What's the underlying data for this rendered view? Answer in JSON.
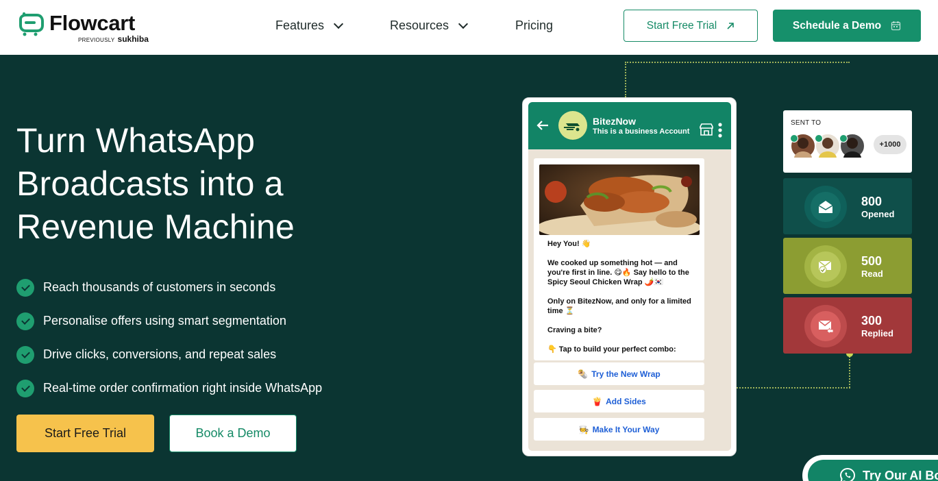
{
  "brand": {
    "name": "Flowcart",
    "previously": "PREVIOUSLY",
    "previous_name": "sukhiba",
    "accent": "#16906b",
    "dark_bg": "#0b3532"
  },
  "nav": {
    "items": [
      {
        "label": "Features",
        "icon": "chevron-down-icon"
      },
      {
        "label": "Resources",
        "icon": "chevron-down-icon"
      },
      {
        "label": "Pricing"
      }
    ],
    "trial_label": "Start Free Trial",
    "trial_icon": "arrow-up-right-icon",
    "demo_label": "Schedule a Demo",
    "demo_icon": "calendar-icon"
  },
  "hero": {
    "title_lines": [
      "Turn WhatsApp",
      "Broadcasts into a",
      "Revenue Machine"
    ],
    "bullets": [
      "Reach thousands of customers in seconds",
      "Personalise offers using smart segmentation",
      "Drive clicks, conversions, and repeat sales",
      "Real-time order confirmation right inside WhatsApp"
    ],
    "cta_primary": "Start Free Trial",
    "cta_primary_color": "#f6c24c",
    "cta_secondary": "Book a Demo"
  },
  "phone": {
    "contact_name": "BitezNow",
    "contact_sub": "This is a business Account",
    "message_lines": [
      "Hey You! 👋",
      "We cooked up something hot — and you're first in line. 😋🔥 Say hello to the Spicy Seoul Chicken Wrap 🌶️🇰🇷",
      "Only on BitezNow, and only for a limited time ⏳",
      "Craving a bite?",
      "👇 Tap to build your perfect combo:"
    ],
    "quick_replies": [
      {
        "emoji": "🌯",
        "label": "Try the New Wrap"
      },
      {
        "emoji": "🍟",
        "label": "Add Sides"
      },
      {
        "emoji": "🧑‍🍳",
        "label": "Make It Your Way"
      }
    ]
  },
  "stats": {
    "sent_to_label": "SENT TO",
    "sent_more": "+1000",
    "cards": [
      {
        "value": "800",
        "label": "Opened",
        "icon": "envelope-icon",
        "bg": "#0f4f4a",
        "ring": "#0f605a",
        "inner": "#156e66"
      },
      {
        "value": "500",
        "label": "Read",
        "icon": "envelope-read-icon",
        "bg": "#8c9d32",
        "ring": "#a3b444",
        "inner": "#b7c65a"
      },
      {
        "value": "300",
        "label": "Replied",
        "icon": "envelope-reply-icon",
        "bg": "#a2383a",
        "ring": "#bd4b4c",
        "inner": "#d85f5f"
      }
    ]
  },
  "ai_bot": {
    "label": "Try Our AI Bo",
    "icon": "whatsapp-icon"
  }
}
